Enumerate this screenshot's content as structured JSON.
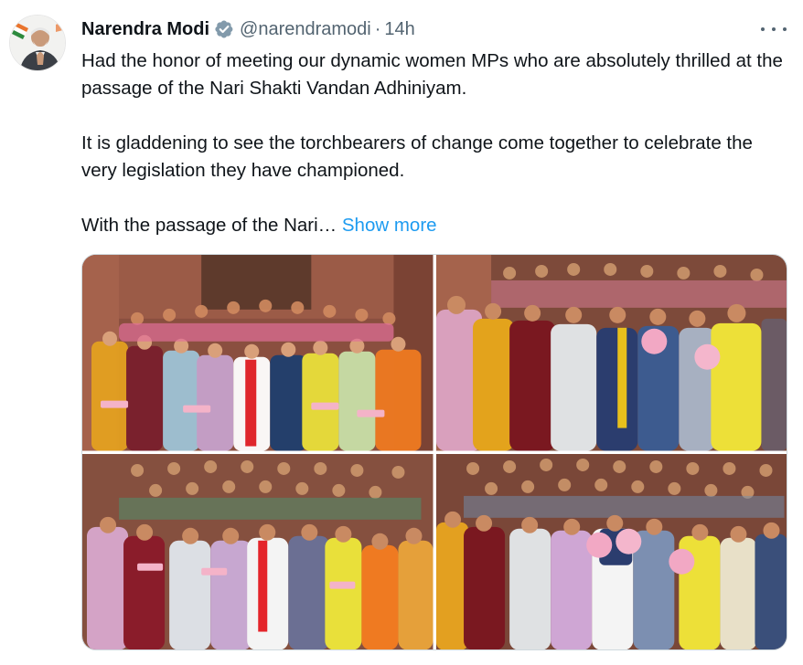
{
  "tweet": {
    "author_name": "Narendra Modi",
    "handle": "@narendramodi",
    "separator": "·",
    "time": "14h",
    "paragraphs": [
      "Had the honor of meeting our dynamic women MPs who are absolutely thrilled at the passage of the Nari Shakti Vandan Adhiniyam.",
      "It is gladdening to see the torchbearers of change come together to celebrate the very legislation they have championed.",
      "With the passage of the Nari…"
    ],
    "show_more": "Show more",
    "icons": {
      "verified": "verified-badge-icon",
      "more": "more-options-icon"
    },
    "colors": {
      "link": "#1d9bf0",
      "verified": "#829aab",
      "secondary_text": "#536471"
    },
    "media_count": 4
  }
}
